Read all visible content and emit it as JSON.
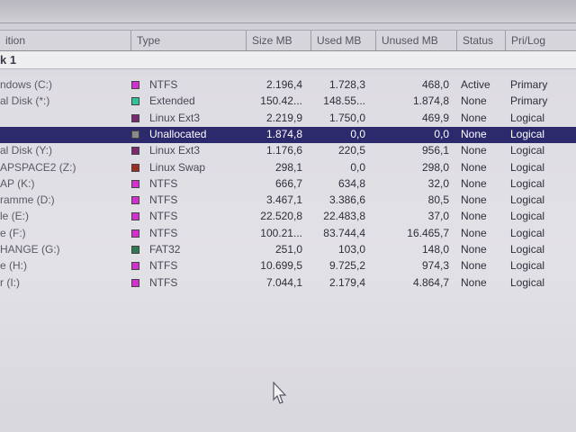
{
  "header": {
    "columns": [
      {
        "key": "partition",
        "label": "ition"
      },
      {
        "key": "type",
        "label": "Type"
      },
      {
        "key": "size",
        "label": "Size MB"
      },
      {
        "key": "used",
        "label": "Used MB"
      },
      {
        "key": "unused",
        "label": "Unused MB"
      },
      {
        "key": "status",
        "label": "Status"
      },
      {
        "key": "prilog",
        "label": "Pri/Log"
      }
    ]
  },
  "disk": {
    "label": "k 1"
  },
  "colors": {
    "ntfs": "#d62fd0",
    "extended": "#2fc49a",
    "linux_ext3": "#7a2a6e",
    "unallocated": "#8a8a8a",
    "linux_swap": "#9a2f24",
    "fat32": "#2f7a52",
    "selection": "#2c2a6c"
  },
  "partitions": [
    {
      "name": "ndows (C:)",
      "type": "NTFS",
      "swatch": "ntfs",
      "size": "2.196,4",
      "used": "1.728,3",
      "unused": "468,0",
      "status": "Active",
      "prilog": "Primary"
    },
    {
      "name": "al Disk (*:)",
      "type": "Extended",
      "swatch": "extended",
      "size": "150.42...",
      "used": "148.55...",
      "unused": "1.874,8",
      "status": "None",
      "prilog": "Primary"
    },
    {
      "name": "",
      "type": "Linux Ext3",
      "swatch": "linux_ext3",
      "size": "2.219,9",
      "used": "1.750,0",
      "unused": "469,9",
      "status": "None",
      "prilog": "Logical"
    },
    {
      "name": "",
      "type": "Unallocated",
      "swatch": "unallocated",
      "size": "1.874,8",
      "used": "0,0",
      "unused": "0,0",
      "status": "None",
      "prilog": "Logical",
      "selected": true
    },
    {
      "name": "al Disk (Y:)",
      "type": "Linux Ext3",
      "swatch": "linux_ext3",
      "size": "1.176,6",
      "used": "220,5",
      "unused": "956,1",
      "status": "None",
      "prilog": "Logical"
    },
    {
      "name": "APSPACE2 (Z:)",
      "type": "Linux Swap",
      "swatch": "linux_swap",
      "size": "298,1",
      "used": "0,0",
      "unused": "298,0",
      "status": "None",
      "prilog": "Logical"
    },
    {
      "name": "AP (K:)",
      "type": "NTFS",
      "swatch": "ntfs",
      "size": "666,7",
      "used": "634,8",
      "unused": "32,0",
      "status": "None",
      "prilog": "Logical"
    },
    {
      "name": "ramme (D:)",
      "type": "NTFS",
      "swatch": "ntfs",
      "size": "3.467,1",
      "used": "3.386,6",
      "unused": "80,5",
      "status": "None",
      "prilog": "Logical"
    },
    {
      "name": "le (E:)",
      "type": "NTFS",
      "swatch": "ntfs",
      "size": "22.520,8",
      "used": "22.483,8",
      "unused": "37,0",
      "status": "None",
      "prilog": "Logical"
    },
    {
      "name": "e (F:)",
      "type": "NTFS",
      "swatch": "ntfs",
      "size": "100.21...",
      "used": "83.744,4",
      "unused": "16.465,7",
      "status": "None",
      "prilog": "Logical"
    },
    {
      "name": "HANGE (G:)",
      "type": "FAT32",
      "swatch": "fat32",
      "size": "251,0",
      "used": "103,0",
      "unused": "148,0",
      "status": "None",
      "prilog": "Logical"
    },
    {
      "name": "e (H:)",
      "type": "NTFS",
      "swatch": "ntfs",
      "size": "10.699,5",
      "used": "9.725,2",
      "unused": "974,3",
      "status": "None",
      "prilog": "Logical"
    },
    {
      "name": "r (I:)",
      "type": "NTFS",
      "swatch": "ntfs",
      "size": "7.044,1",
      "used": "2.179,4",
      "unused": "4.864,7",
      "status": "None",
      "prilog": "Logical"
    }
  ]
}
